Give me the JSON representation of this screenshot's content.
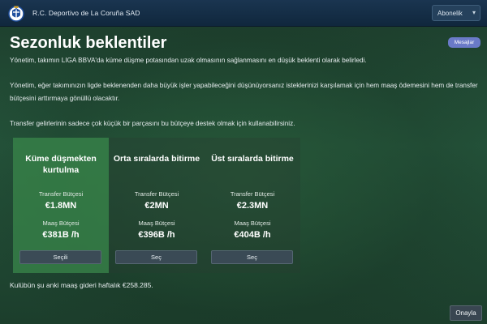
{
  "header": {
    "club_name": "R.C. Deportivo de La Coruña SAD",
    "crest_icon": "club-crest-icon",
    "subscription_select": "Abonelik",
    "chevron_icon": "chevron-down-icon"
  },
  "page": {
    "title": "Sezonluk beklentiler",
    "messages_button": "Mesajlar",
    "paragraphs": [
      "Yönetim, takımın LIGA BBVA'da küme düşme potasından uzak olmasının sağlanmasını en düşük beklenti olarak belirledi.",
      "Yönetim, eğer takımınızın ligde beklenenden daha büyük işler yapabileceğini düşünüyorsanız isteklerinizi karşılamak için hem maaş ödemesini hem de transfer bütçesini arttırmaya gönüllü olacaktır.",
      "Transfer gelirlerinin sadece çok küçük bir parçasını bu bütçeye destek olmak için kullanabilirsiniz."
    ]
  },
  "options": [
    {
      "title": "Küme düşmekten kurtulma",
      "transfer_label": "Transfer Bütçesi",
      "transfer_value": "€1.8MN",
      "wage_label": "Maaş Bütçesi",
      "wage_value": "€381B /h",
      "button": "Seçili",
      "selected": true
    },
    {
      "title": "Orta sıralarda bitirme",
      "transfer_label": "Transfer Bütçesi",
      "transfer_value": "€2MN",
      "wage_label": "Maaş Bütçesi",
      "wage_value": "€396B /h",
      "button": "Seç",
      "selected": false
    },
    {
      "title": "Üst sıralarda bitirme",
      "transfer_label": "Transfer Bütçesi",
      "transfer_value": "€2.3MN",
      "wage_label": "Maaş Bütçesi",
      "wage_value": "€404B /h",
      "button": "Seç",
      "selected": false
    }
  ],
  "footer": {
    "current_wage": "Kulübün şu anki maaş gideri haftalık €258.285.",
    "confirm_button": "Onayla"
  },
  "colors": {
    "selected_option": "#3a874b",
    "messages_button": "#6a7ac8",
    "topbar": "#10273d"
  }
}
